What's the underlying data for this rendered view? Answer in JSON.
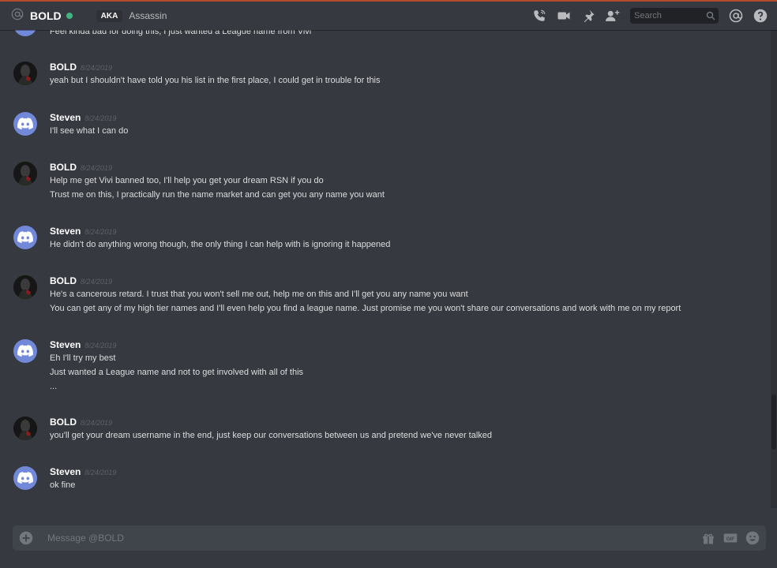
{
  "header": {
    "username": "BOLD",
    "aka_badge": "AKA",
    "nickname": "Assassin",
    "search_placeholder": "Search"
  },
  "messages": {
    "partial_line": "Feel kinda bad for doing this, I just wanted a League name from Vivi",
    "groups": [
      {
        "author": "BOLD",
        "timestamp": "8/24/2019",
        "avatar": "bold-avatar",
        "lines": [
          "yeah but I shouldn't have told you his list in the first place, I could get in trouble for this"
        ]
      },
      {
        "author": "Steven",
        "timestamp": "8/24/2019",
        "avatar": "discord-avatar",
        "lines": [
          "I'll see what I can do"
        ]
      },
      {
        "author": "BOLD",
        "timestamp": "8/24/2019",
        "avatar": "bold-avatar",
        "lines": [
          "Help me get Vivi banned too, I'll help you get your dream RSN if you do",
          "Trust me on this, I practically run the name market and can get you any name you want"
        ]
      },
      {
        "author": "Steven",
        "timestamp": "8/24/2019",
        "avatar": "discord-avatar",
        "lines": [
          "He didn't do anything wrong though, the only thing I can help with is ignoring it happened"
        ]
      },
      {
        "author": "BOLD",
        "timestamp": "8/24/2019",
        "avatar": "bold-avatar",
        "lines": [
          "He's a cancerous retard. I trust that you won't sell me out, help me on this and I'll get you any name you want",
          "You can get any of my high tier names and I'll even help you find a league name. Just promise me you won't share our conversations and work with me on my report"
        ]
      },
      {
        "author": "Steven",
        "timestamp": "8/24/2019",
        "avatar": "discord-avatar",
        "lines": [
          "Eh I'll try my best",
          "Just wanted a League name and not to get involved with all of this",
          "..."
        ]
      },
      {
        "author": "BOLD",
        "timestamp": "8/24/2019",
        "avatar": "bold-avatar",
        "lines": [
          "you'll get your dream username in the end, just keep our conversations between us and pretend we've never talked"
        ]
      },
      {
        "author": "Steven",
        "timestamp": "8/24/2019",
        "avatar": "discord-avatar",
        "lines": [
          "ok fine"
        ]
      }
    ]
  },
  "composer": {
    "placeholder": "Message @BOLD",
    "gif_label": "GIF"
  },
  "colors": {
    "background": "#36393f",
    "blurple": "#7289da",
    "online": "#43b581"
  }
}
